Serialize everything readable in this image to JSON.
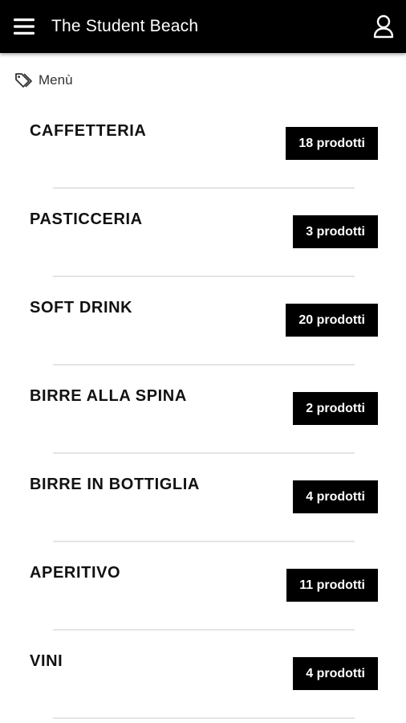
{
  "header": {
    "title": "The Student Beach",
    "menu_icon": "hamburger-menu-icon",
    "user_icon": "user-icon",
    "background_color": "#000000",
    "text_color": "#ffffff"
  },
  "breadcrumb": {
    "icon": "tag-icon",
    "label": "Menù"
  },
  "categories": [
    {
      "name": "CAFFETTERIA",
      "count_label": "18 prodotti"
    },
    {
      "name": "PASTICCERIA",
      "count_label": "3 prodotti"
    },
    {
      "name": "SOFT DRINK",
      "count_label": "20 prodotti"
    },
    {
      "name": "BIRRE ALLA SPINA",
      "count_label": "2 prodotti"
    },
    {
      "name": "BIRRE IN BOTTIGLIA",
      "count_label": "4 prodotti"
    },
    {
      "name": "APERITIVO",
      "count_label": "11 prodotti"
    },
    {
      "name": "VINI",
      "count_label": "4 prodotti"
    }
  ],
  "colors": {
    "badge_background": "#000000",
    "badge_text": "#ffffff",
    "divider": "#e4e4e4"
  }
}
